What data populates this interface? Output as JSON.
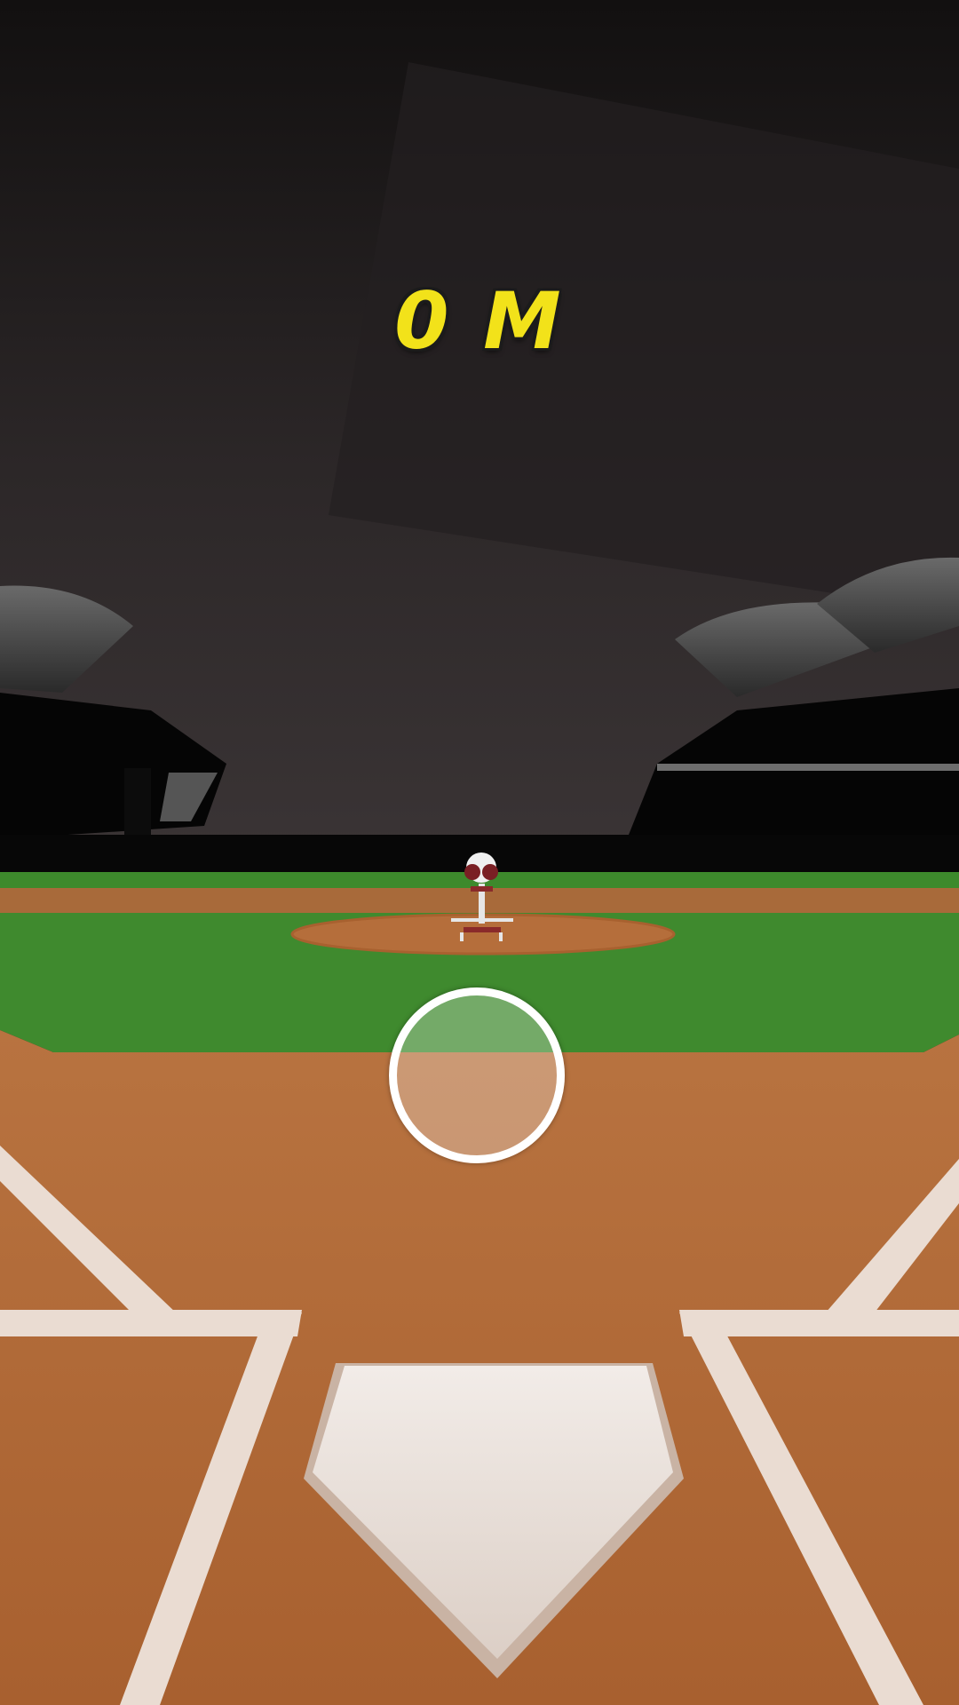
{
  "hud": {
    "distance_readout": "0 M"
  },
  "scene": {
    "aim_target_icon": "target-circle-icon",
    "pitching_machine_icon": "pitching-machine-icon",
    "home_plate_icon": "home-plate-icon"
  },
  "colors": {
    "distance_text": "#f2e21a",
    "sky": "#2a2627",
    "grass": "#3f8a2e",
    "dirt": "#b8703a",
    "chalk": "#efe3da",
    "aim_ring": "#ffffff"
  }
}
